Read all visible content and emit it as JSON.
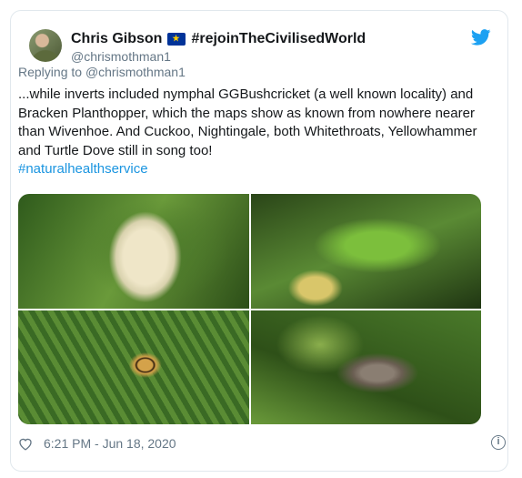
{
  "tweet": {
    "display_name": "Chris Gibson",
    "name_suffix": "#rejoinTheCivilisedWorld",
    "handle": "@chrismothman1",
    "replying_prefix": "Replying to ",
    "replying_to": "@chrismothman1",
    "body": "...while inverts included nymphal GGBushcricket (a well known locality) and Bracken Planthopper, which the maps show as known from nowhere nearer than Wivenhoe. And Cuckoo, Nightingale, both Whitethroats, Yellowhammer and Turtle Dove still in song too!",
    "hashtag": "#naturalhealthservice",
    "timestamp": "6:21 PM - Jun 18, 2020",
    "like_icon": "heart-icon",
    "info_icon": "info-icon",
    "brand_icon": "twitter-bird-icon"
  },
  "colors": {
    "link": "#1b95e0",
    "muted": "#657786",
    "text": "#14171a",
    "border": "#e1e8ed",
    "twitter_blue": "#1da1f2",
    "eu_flag": "#003399"
  }
}
